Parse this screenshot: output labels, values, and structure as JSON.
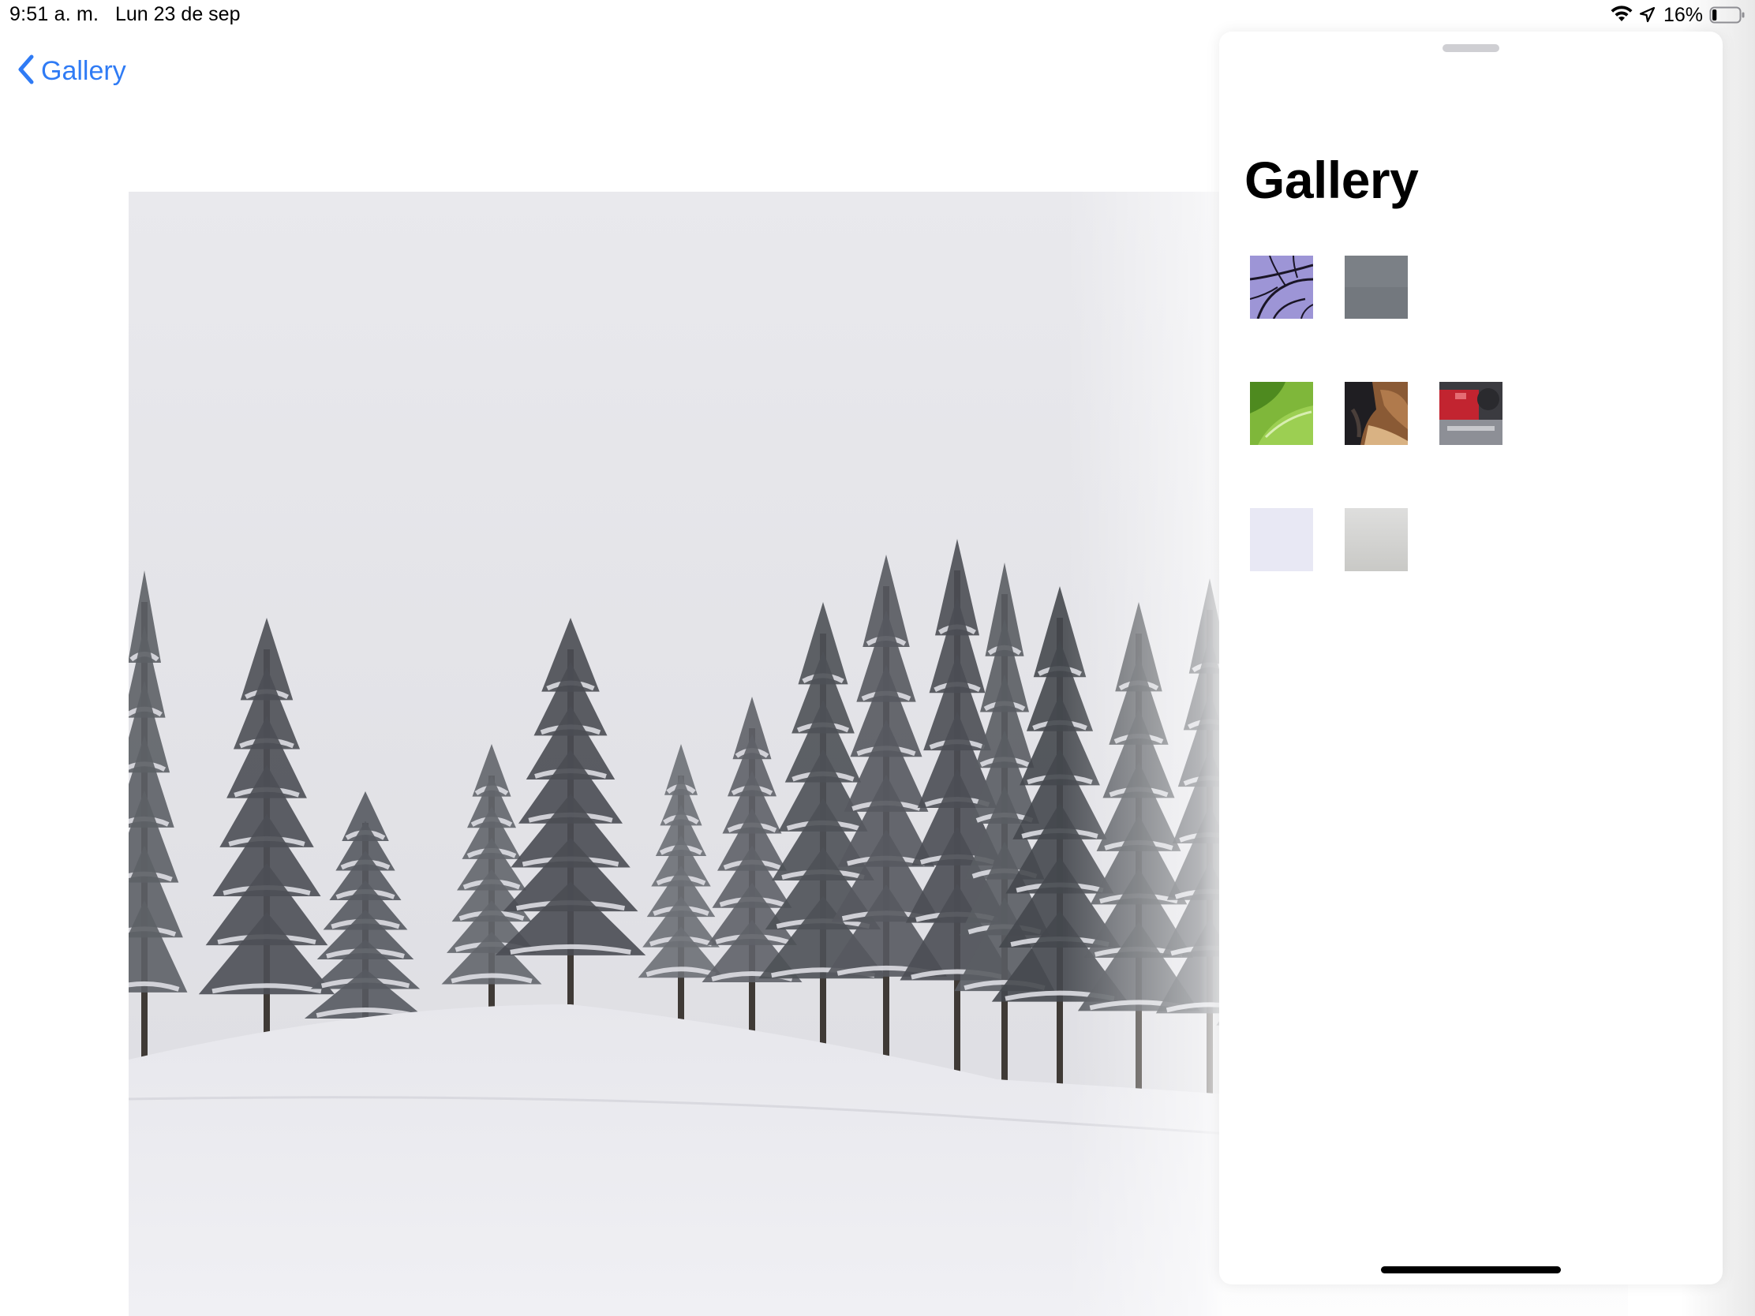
{
  "status_bar": {
    "time": "9:51 a. m.",
    "date": "Lun 23 de sep",
    "battery_percent": "16%",
    "battery_level": 0.16,
    "icons": [
      "wifi-icon",
      "location-arrow-icon",
      "battery-icon"
    ]
  },
  "nav": {
    "back_label": "Gallery",
    "back_icon": "chevron-left-icon"
  },
  "photo": {
    "subject": "snowy-forest-photo"
  },
  "sheet": {
    "title": "Gallery",
    "thumbnails": [
      {
        "name": "thumbnail-branches"
      },
      {
        "name": "thumbnail-gray"
      },
      {
        "name": "thumbnail-leaves"
      },
      {
        "name": "thumbnail-dog"
      },
      {
        "name": "thumbnail-red-car"
      },
      {
        "name": "thumbnail-lavender"
      },
      {
        "name": "thumbnail-light-gray"
      }
    ]
  },
  "colors": {
    "accent": "#2f7bf5",
    "sheet_background": "#ffffff",
    "text": "#000000"
  }
}
